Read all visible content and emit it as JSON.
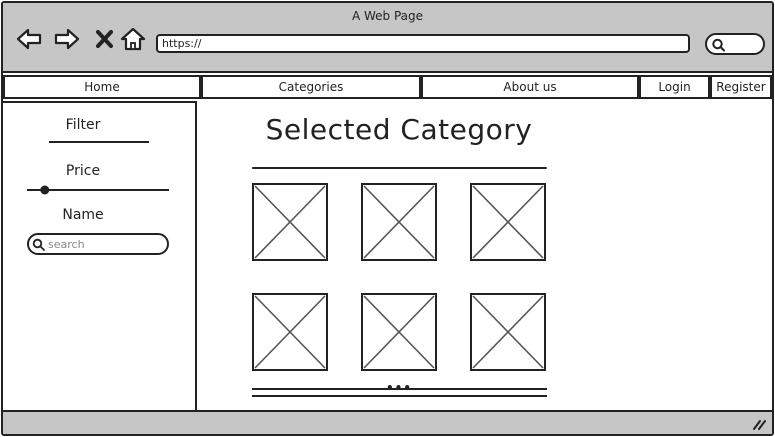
{
  "browser": {
    "window_title": "A Web Page",
    "url": "https://",
    "icons": [
      "back-arrow-icon",
      "forward-arrow-icon",
      "stop-icon",
      "home-icon",
      "search-icon"
    ]
  },
  "nav": {
    "home": "Home",
    "categories": "Categories",
    "about": "About us",
    "login": "Login",
    "register": "Register"
  },
  "sidebar": {
    "filter_heading": "Filter",
    "price_heading": "Price",
    "price_slider_value": 0.1,
    "name_heading": "Name",
    "search_placeholder": "search"
  },
  "main": {
    "title": "Selected Category",
    "image_count": 6,
    "pager_dots": "•••"
  }
}
